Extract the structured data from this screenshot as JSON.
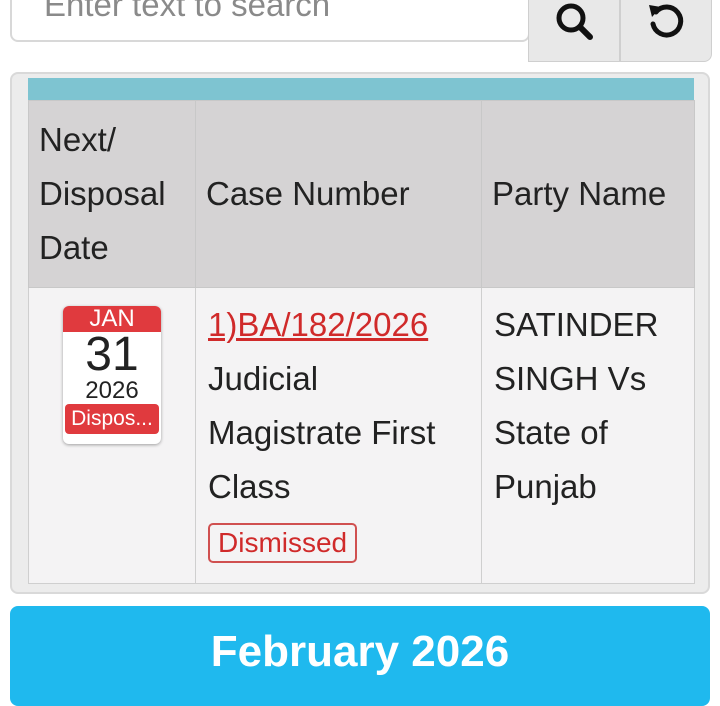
{
  "search": {
    "placeholder": "Enter text to search"
  },
  "table": {
    "headers": [
      "Next/ Disposal Date",
      "Case Number",
      "Party Name"
    ],
    "rows": [
      {
        "date": {
          "month": "JAN",
          "day": "31",
          "year": "2026",
          "status": "Dispos..."
        },
        "case_number": "1)BA/182/2026",
        "court": "Judicial Magistrate First Class",
        "status_badge": "Dismissed",
        "party_name": "SATINDER SINGH Vs State of Punjab"
      }
    ]
  },
  "month_header": "February 2026",
  "colors": {
    "accent_red": "#e03a3e",
    "header_bar": "#7ec4d1",
    "month_bar": "#1fb9ee"
  },
  "icons": [
    "search-icon",
    "refresh-icon"
  ]
}
